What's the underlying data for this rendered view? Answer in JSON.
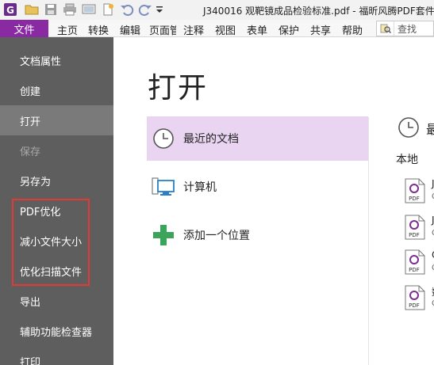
{
  "window": {
    "title": "J340016 观靶镜成品检验标准.pdf - 福昕风腾PDF套件"
  },
  "quick_access": {
    "icons": [
      "app-logo-icon",
      "open-folder-icon",
      "save-icon",
      "print-icon",
      "screen-icon",
      "new-icon",
      "undo-icon",
      "redo-icon",
      "customize-dropdown-icon"
    ]
  },
  "menubar": {
    "file_label": "文件",
    "items": [
      "主页",
      "转换",
      "编辑",
      "页面管",
      "注释",
      "视图",
      "表单",
      "保护",
      "共享",
      "帮助"
    ],
    "search_placeholder": "查找"
  },
  "sidebar": {
    "items": [
      {
        "label": "文档属性",
        "state": "normal"
      },
      {
        "label": "创建",
        "state": "normal"
      },
      {
        "label": "打开",
        "state": "active"
      },
      {
        "label": "保存",
        "state": "disabled"
      },
      {
        "label": "另存为",
        "state": "normal"
      },
      {
        "label": "PDF优化",
        "state": "normal"
      },
      {
        "label": "减小文件大小",
        "state": "normal"
      },
      {
        "label": "优化扫描文件",
        "state": "normal"
      },
      {
        "label": "导出",
        "state": "normal"
      },
      {
        "label": "辅助功能检查器",
        "state": "normal"
      },
      {
        "label": "打印",
        "state": "normal"
      }
    ]
  },
  "main": {
    "title": "打开",
    "options": [
      {
        "label": "最近的文档",
        "icon": "clock-icon",
        "selected": true
      },
      {
        "label": "计算机",
        "icon": "computer-icon",
        "selected": false
      },
      {
        "label": "添加一个位置",
        "icon": "plus-icon",
        "selected": false
      }
    ],
    "recent_header": "最",
    "local_label": "本地",
    "files": [
      {
        "name": "J",
        "path": "C"
      },
      {
        "name": "J",
        "path": "C"
      },
      {
        "name": "C",
        "path": "C"
      },
      {
        "name": "数",
        "path": "C"
      }
    ]
  },
  "colors": {
    "file_tab": "#8a2aa3",
    "sidebar_bg": "#5e5e5e",
    "sidebar_active": "#7a7a7a",
    "selected_option": "#e9d5f1",
    "highlight_box": "#e53935",
    "plus_green": "#3aa55a"
  }
}
